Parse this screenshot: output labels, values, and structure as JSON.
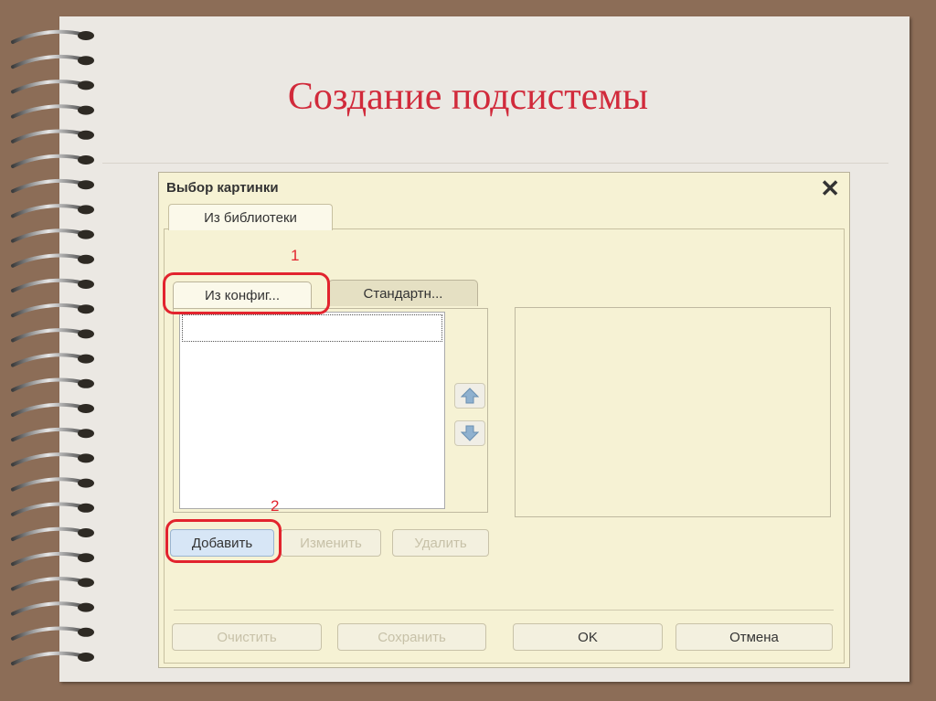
{
  "slide": {
    "title": "Создание подсистемы"
  },
  "dialog": {
    "title": "Выбор картинки",
    "outer_tab": "Из библиотеки",
    "inner_tabs": [
      "Из конфиг...",
      "Стандартн..."
    ],
    "buttons": {
      "add": "Добавить",
      "edit": "Изменить",
      "delete": "Удалить",
      "clear": "Очистить",
      "save": "Сохранить",
      "ok": "OK",
      "cancel": "Отмена"
    }
  },
  "annotations": {
    "step1": "1",
    "step2": "2"
  },
  "icons": {
    "close": "close-icon",
    "move_up": "arrow-up-icon",
    "move_down": "arrow-down-icon"
  },
  "colors": {
    "title": "#d12a3b",
    "highlight": "#e2242e",
    "background": "#8c6d57",
    "dialog": "#f6f2d4"
  }
}
